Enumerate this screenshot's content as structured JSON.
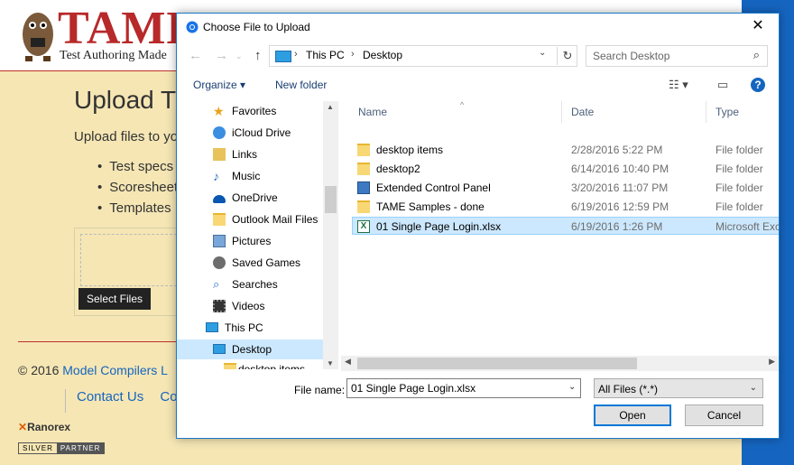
{
  "site": {
    "logo_text": "TAME",
    "tagline": "Test Authoring Made",
    "page_title": "Upload T",
    "intro": "Upload files to yo",
    "bullets": [
      "Test specs",
      "Scoresheet",
      "Templates"
    ],
    "select_files": "Select Files",
    "copyright_prefix": "© 2016 ",
    "copyright_link": "Model Compilers L",
    "footer_links": [
      "Contact Us",
      "Co"
    ],
    "ranorex": "Ranorex",
    "partner_1": "SILVER",
    "partner_2": "PARTNER"
  },
  "dialog": {
    "title": "Choose File to Upload",
    "close": "✕",
    "address": {
      "crumbs": [
        "This PC",
        "Desktop"
      ]
    },
    "search_placeholder": "Search Desktop",
    "toolbar": {
      "organize": "Organize ▾",
      "new_folder": "New folder"
    },
    "nav_items": [
      {
        "label": "Favorites",
        "icon": "star-icon"
      },
      {
        "label": "iCloud Drive",
        "icon": "cloud-icon"
      },
      {
        "label": "Links",
        "icon": "link-icon"
      },
      {
        "label": "Music",
        "icon": "music-icon"
      },
      {
        "label": "OneDrive",
        "icon": "onedrive-icon"
      },
      {
        "label": "Outlook Mail Files",
        "icon": "folder-icon"
      },
      {
        "label": "Pictures",
        "icon": "pictures-icon"
      },
      {
        "label": "Saved Games",
        "icon": "games-icon"
      },
      {
        "label": "Searches",
        "icon": "search-icon"
      },
      {
        "label": "Videos",
        "icon": "video-icon"
      },
      {
        "label": "This PC",
        "icon": "computer-icon"
      },
      {
        "label": "Desktop",
        "icon": "desktop-icon"
      },
      {
        "label": "desktop items",
        "icon": "folder-icon"
      }
    ],
    "columns": [
      "Name",
      "Date",
      "Type"
    ],
    "files": [
      {
        "name": "desktop items",
        "date": "2/28/2016 5:22 PM",
        "type": "File folder",
        "icon": "folder-icon"
      },
      {
        "name": "desktop2",
        "date": "6/14/2016 10:40 PM",
        "type": "File folder",
        "icon": "folder-icon"
      },
      {
        "name": "Extended Control Panel",
        "date": "3/20/2016 11:07 PM",
        "type": "File folder",
        "icon": "control-panel-icon"
      },
      {
        "name": "TAME Samples - done",
        "date": "6/19/2016 12:59 PM",
        "type": "File folder",
        "icon": "folder-icon"
      },
      {
        "name": "01 Single Page Login.xlsx",
        "date": "6/19/2016 1:26 PM",
        "type": "Microsoft Exc",
        "icon": "excel-icon"
      }
    ],
    "selected_file": 4,
    "file_name_label": "File name:",
    "file_name_value": "01 Single Page Login.xlsx",
    "filter": "All Files (*.*)",
    "open": "Open",
    "cancel": "Cancel"
  },
  "colors": {
    "accent": "#0078d7",
    "brand_red": "#b8292a",
    "site_bg": "#f5e6b4",
    "selection": "#cce8ff"
  }
}
